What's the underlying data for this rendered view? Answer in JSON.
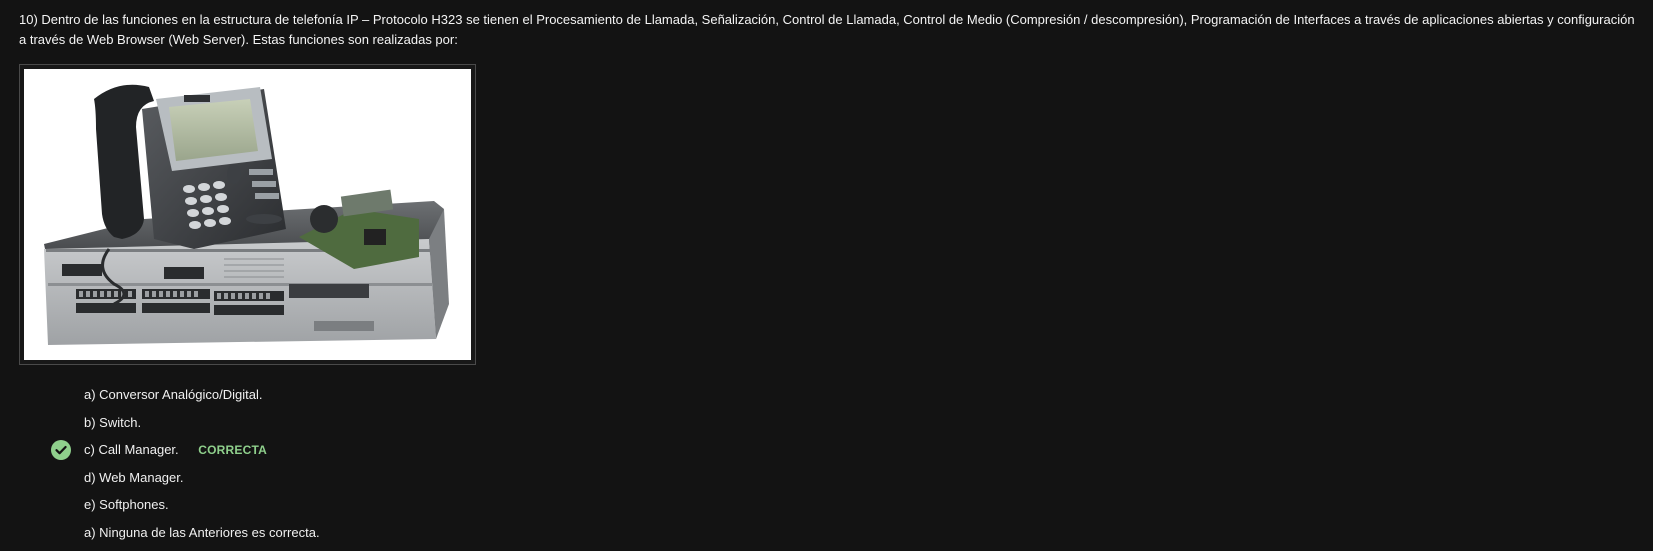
{
  "question": {
    "text": "10) Dentro de las funciones en la estructura de telefonía IP – Protocolo H323 se tienen el Procesamiento de Llamada, Señalización, Control de Llamada, Control de Medio (Compresión / descompresión), Programación de Interfaces a través de aplicaciones abiertas y configuración a través de Web Browser (Web Server). Estas funciones son realizadas por:"
  },
  "image": {
    "content": "ip-phone-and-router-photo"
  },
  "options": [
    {
      "label": "a) Conversor Analógico/Digital."
    },
    {
      "label": "b) Switch."
    },
    {
      "label": "c) Call Manager.",
      "badge": "CORRECTA",
      "correct": true
    },
    {
      "label": "d) Web Manager."
    },
    {
      "label": "e) Softphones."
    },
    {
      "label": "a) Ninguna de las Anteriores es correcta."
    }
  ],
  "colors": {
    "background": "#131313",
    "text": "#f2f2f2",
    "correct": "#8fd08c"
  },
  "icons": {
    "correct": "check-circle-icon"
  }
}
